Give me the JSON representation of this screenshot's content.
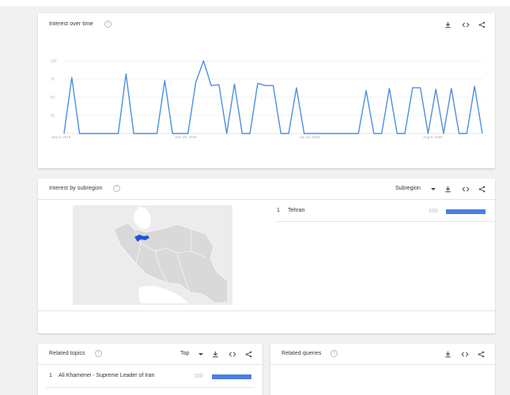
{
  "interest_over_time": {
    "title": "Interest over time",
    "help_glyph": "?",
    "icons": [
      "download-icon",
      "embed-icon",
      "share-icon"
    ]
  },
  "interest_by_subregion": {
    "title": "Interest by subregion",
    "help_glyph": "?",
    "dropdown_value": "Subregion",
    "rows": [
      {
        "rank": "1",
        "name": "Tehran",
        "value": "100",
        "fraction": 1.0
      }
    ]
  },
  "related_topics": {
    "title": "Related topics",
    "help_glyph": "?",
    "dropdown_value": "Top",
    "rows": [
      {
        "rank": "1",
        "name": "Ali Khamenei - Supreme Leader of Iran",
        "value": "100",
        "fraction": 1.0
      }
    ]
  },
  "related_queries": {
    "title": "Related queries",
    "help_glyph": "?"
  },
  "colors": {
    "line": "#4a90e2",
    "bar": "#4a7fe6",
    "map_land": "#dcdcdc",
    "map_highlight": "#1e55d8"
  },
  "chart_data": {
    "type": "line",
    "title": "",
    "xlabel": "",
    "ylabel": "",
    "ylim": [
      0,
      100
    ],
    "y_ticks": [
      "100",
      "75",
      "50",
      "25"
    ],
    "x_tick_labels": [
      "Sep 8, 2019",
      "Dec 29, 2019",
      "Apr 19, 2020",
      "Aug 9, 2020"
    ],
    "x_tick_index": [
      0,
      16,
      32,
      48
    ],
    "grid": true,
    "series": [
      {
        "values": [
          0,
          77,
          0,
          0,
          0,
          0,
          0,
          0,
          82,
          0,
          0,
          0,
          0,
          73,
          0,
          0,
          0,
          70,
          100,
          66,
          67,
          0,
          68,
          0,
          0,
          69,
          66,
          66,
          0,
          0,
          63,
          0,
          0,
          0,
          0,
          0,
          0,
          0,
          0,
          59,
          0,
          0,
          62,
          0,
          0,
          63,
          63,
          0,
          61,
          0,
          62,
          0,
          0,
          65,
          0
        ]
      }
    ]
  }
}
